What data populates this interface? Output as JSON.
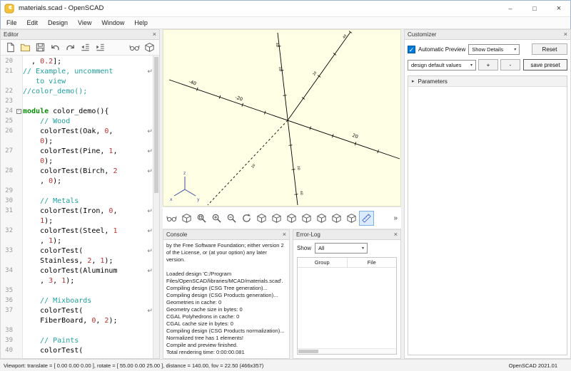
{
  "ui": {
    "close_glyph": "×",
    "minimize_glyph": "–",
    "maximize_glyph": "□",
    "chevron": "▾",
    "triangle": "▸",
    "overflow": "»"
  },
  "window": {
    "title": "materials.scad - OpenSCAD"
  },
  "menu": {
    "items": [
      "File",
      "Edit",
      "Design",
      "View",
      "Window",
      "Help"
    ]
  },
  "editor": {
    "title": "Editor",
    "toolbar_left": [
      "new-file",
      "open",
      "save",
      "undo",
      "redo",
      "unindent",
      "indent"
    ],
    "toolbar_right": [
      "preview",
      "render"
    ],
    "code_rows": [
      {
        "n": "20",
        "seg": [
          [
            "  , ",
            "p"
          ],
          [
            "0.2",
            "n"
          ],
          [
            "];",
            "p"
          ]
        ]
      },
      {
        "n": "21",
        "w": 1,
        "seg": [
          [
            "// Example, uncomment",
            "c"
          ]
        ]
      },
      {
        "n": "",
        "seg": [
          [
            "   to view",
            "c"
          ]
        ]
      },
      {
        "n": "22",
        "seg": [
          [
            "//color_demo();",
            "c"
          ]
        ]
      },
      {
        "n": "23",
        "seg": []
      },
      {
        "n": "24",
        "f": 1,
        "seg": [
          [
            "module",
            "k"
          ],
          [
            " color_demo(){",
            "p"
          ]
        ]
      },
      {
        "n": "25",
        "seg": [
          [
            "    // Wood",
            "c"
          ]
        ]
      },
      {
        "n": "26",
        "w": 1,
        "seg": [
          [
            "    colorTest(Oak, ",
            "p"
          ],
          [
            "0",
            "n"
          ],
          [
            ",",
            "p"
          ]
        ]
      },
      {
        "n": "",
        "seg": [
          [
            "    ",
            "p"
          ],
          [
            "0",
            "n"
          ],
          [
            ");",
            "p"
          ]
        ]
      },
      {
        "n": "27",
        "w": 1,
        "seg": [
          [
            "    colorTest(Pine, ",
            "p"
          ],
          [
            "1",
            "n"
          ],
          [
            ",",
            "p"
          ]
        ]
      },
      {
        "n": "",
        "seg": [
          [
            "    ",
            "p"
          ],
          [
            "0",
            "n"
          ],
          [
            ");",
            "p"
          ]
        ]
      },
      {
        "n": "28",
        "w": 1,
        "seg": [
          [
            "    colorTest(Birch, ",
            "p"
          ],
          [
            "2",
            "n"
          ]
        ]
      },
      {
        "n": "",
        "seg": [
          [
            "    , ",
            "p"
          ],
          [
            "0",
            "n"
          ],
          [
            ");",
            "p"
          ]
        ]
      },
      {
        "n": "29",
        "seg": []
      },
      {
        "n": "30",
        "seg": [
          [
            "    // Metals",
            "c"
          ]
        ]
      },
      {
        "n": "31",
        "w": 1,
        "seg": [
          [
            "    colorTest(Iron, ",
            "p"
          ],
          [
            "0",
            "n"
          ],
          [
            ",",
            "p"
          ]
        ]
      },
      {
        "n": "",
        "seg": [
          [
            "    ",
            "p"
          ],
          [
            "1",
            "n"
          ],
          [
            ");",
            "p"
          ]
        ]
      },
      {
        "n": "32",
        "w": 1,
        "seg": [
          [
            "    colorTest(Steel, ",
            "p"
          ],
          [
            "1",
            "n"
          ]
        ]
      },
      {
        "n": "",
        "seg": [
          [
            "    , ",
            "p"
          ],
          [
            "1",
            "n"
          ],
          [
            ");",
            "p"
          ]
        ]
      },
      {
        "n": "33",
        "w": 1,
        "seg": [
          [
            "    colorTest(",
            "p"
          ]
        ]
      },
      {
        "n": "",
        "seg": [
          [
            "    Stainless, ",
            "p"
          ],
          [
            "2",
            "n"
          ],
          [
            ", ",
            "p"
          ],
          [
            "1",
            "n"
          ],
          [
            ");",
            "p"
          ]
        ]
      },
      {
        "n": "34",
        "w": 1,
        "seg": [
          [
            "    colorTest(Aluminum",
            "p"
          ]
        ]
      },
      {
        "n": "",
        "seg": [
          [
            "    , ",
            "p"
          ],
          [
            "3",
            "n"
          ],
          [
            ", ",
            "p"
          ],
          [
            "1",
            "n"
          ],
          [
            ");",
            "p"
          ]
        ]
      },
      {
        "n": "35",
        "seg": []
      },
      {
        "n": "36",
        "seg": [
          [
            "    // Mixboards",
            "c"
          ]
        ]
      },
      {
        "n": "37",
        "w": 1,
        "seg": [
          [
            "    colorTest(",
            "p"
          ]
        ]
      },
      {
        "n": "",
        "seg": [
          [
            "    FiberBoard, ",
            "p"
          ],
          [
            "0",
            "n"
          ],
          [
            ", ",
            "p"
          ],
          [
            "2",
            "n"
          ],
          [
            ");",
            "p"
          ]
        ]
      },
      {
        "n": "38",
        "seg": []
      },
      {
        "n": "39",
        "seg": [
          [
            "    // Paints",
            "c"
          ]
        ]
      },
      {
        "n": "40",
        "seg": [
          [
            "    colorTest(",
            "p"
          ]
        ]
      }
    ]
  },
  "viewport": {
    "background": "#FFFFE5",
    "toolbar": [
      {
        "name": "preview"
      },
      {
        "name": "render"
      },
      {
        "name": "view-all"
      },
      {
        "name": "zoom-in"
      },
      {
        "name": "zoom-out"
      },
      {
        "name": "reset-view"
      },
      {
        "name": "view-right"
      },
      {
        "name": "view-top"
      },
      {
        "name": "view-bottom"
      },
      {
        "name": "view-left"
      },
      {
        "name": "view-front"
      },
      {
        "name": "view-back"
      },
      {
        "name": "view-diagonal"
      },
      {
        "name": "measure-distance",
        "active": true
      }
    ],
    "labels": {
      "xneg40": "-40",
      "xneg20": "-20",
      "xpos20": "20",
      "t20": "20",
      "t40": "40",
      "axisx": "x",
      "axisy": "y",
      "axisz": "z"
    }
  },
  "console": {
    "title": "Console",
    "lines": [
      "by the Free Software Foundation; either version 2 of the License, or (at your option) any later version.",
      "",
      "Loaded design 'C:/Program Files/OpenSCAD/libraries/MCAD/materials.scad'.",
      "Compiling design (CSG Tree generation)...",
      "Compiling design (CSG Products generation)...",
      "Geometries in cache: 0",
      "Geometry cache size in bytes: 0",
      "CGAL Polyhedrons in cache: 0",
      "CGAL cache size in bytes: 0",
      "Compiling design (CSG Products normalization)...",
      "Normalized tree has 1 elements!",
      "Compile and preview finished.",
      "Total rendering time: 0:00:00.081"
    ]
  },
  "errorlog": {
    "title": "Error-Log",
    "show_label": "Show",
    "filter_value": "All",
    "columns": [
      "Group",
      "File"
    ]
  },
  "customizer": {
    "title": "Customizer",
    "automatic_preview_label": "Automatic Preview",
    "automatic_preview_checked": "✓",
    "details_value": "Show Details",
    "reset_label": "Reset",
    "preset_value": "design default values",
    "add_label": "+",
    "remove_label": "-",
    "save_label": "save preset",
    "parameters_label": "Parameters"
  },
  "statusbar": {
    "left": "Viewport: translate = [ 0.00 0.00 0.00 ], rotate = [ 55.00 0.00 25.00 ], distance = 140.00, fov = 22.50 (466x357)",
    "right": "OpenSCAD 2021.01"
  }
}
